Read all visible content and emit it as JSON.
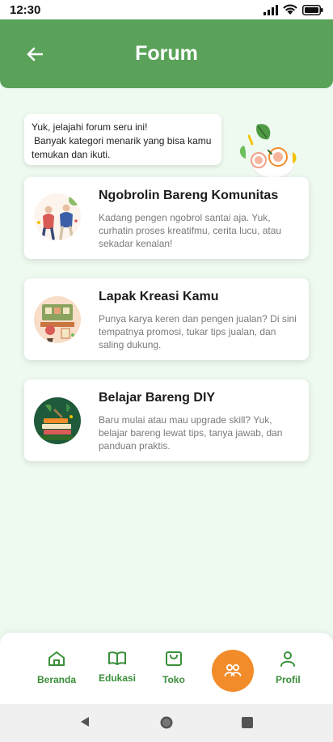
{
  "status": {
    "time": "12:30"
  },
  "header": {
    "title": "Forum"
  },
  "intro": {
    "lines": [
      "Yuk, jelajahi forum seru ini!",
      "Banyak kategori menarik yang bisa kamu",
      "temukan dan ikuti."
    ]
  },
  "categories": [
    {
      "title": "Ngobrolin Bareng Komunitas",
      "description": "Kadang pengen ngobrol santai aja. Yuk, curhatin proses kreatifmu, cerita lucu, atau sekadar kenalan!",
      "icon": "community-chat-illustration"
    },
    {
      "title": "Lapak Kreasi Kamu",
      "description": "Punya karya keren dan pengen jualan? Di sini tempatnya promosi, tukar tips jualan, dan saling dukung.",
      "icon": "craft-market-illustration"
    },
    {
      "title": "Belajar Bareng DIY",
      "description": "Baru mulai atau mau upgrade skill? Yuk, belajar bareng lewat tips, tanya jawab, dan panduan praktis.",
      "icon": "diy-books-illustration"
    }
  ],
  "bottom_nav": [
    {
      "label": "Beranda",
      "icon": "home-icon"
    },
    {
      "label": "Edukasi",
      "icon": "book-icon"
    },
    {
      "label": "Toko",
      "icon": "shopping-bag-icon"
    },
    {
      "label": "",
      "icon": "forum-people-icon",
      "active": true
    },
    {
      "label": "Profil",
      "icon": "user-icon"
    }
  ],
  "colors": {
    "primary": "#5aa259",
    "accent": "#f28c2a",
    "background": "#eefaf0"
  }
}
